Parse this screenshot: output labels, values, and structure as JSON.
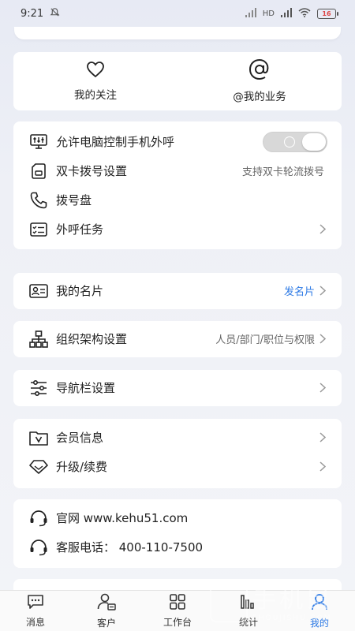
{
  "status_bar": {
    "time": "9:21",
    "network": "HD",
    "battery": "16"
  },
  "quick_links": [
    {
      "label": "我的关注",
      "icon": "heart-icon"
    },
    {
      "label": "@我的业务",
      "icon": "at-icon"
    }
  ],
  "dial_section": {
    "items": [
      {
        "title": "允许电脑控制手机外呼",
        "icon": "monitor-control-icon",
        "toggle": false
      },
      {
        "title": "双卡拨号设置",
        "icon": "sim-card-icon",
        "value": "支持双卡轮流拨号"
      },
      {
        "title": "拨号盘",
        "icon": "phone-icon"
      },
      {
        "title": "外呼任务",
        "icon": "task-list-icon"
      }
    ]
  },
  "business_card": {
    "title": "我的名片",
    "value": "发名片"
  },
  "org_setting": {
    "title": "组织架构设置",
    "value": "人员/部门/职位与权限"
  },
  "nav_setting": {
    "title": "导航栏设置"
  },
  "member": {
    "items": [
      {
        "title": "会员信息"
      },
      {
        "title": "升级/续费"
      }
    ]
  },
  "contact": {
    "website": "官网 www.kehu51.com",
    "hotline": "客服电话：  400-110-7500"
  },
  "tabs": [
    {
      "label": "消息",
      "icon": "message-icon"
    },
    {
      "label": "客户",
      "icon": "customer-icon"
    },
    {
      "label": "工作台",
      "icon": "workbench-icon"
    },
    {
      "label": "统计",
      "icon": "statistics-icon"
    },
    {
      "label": "我的",
      "icon": "profile-icon",
      "active": true
    }
  ],
  "colors": {
    "accent": "#2f7be5",
    "toggle_off": "#d8d8d8"
  },
  "watermark": {
    "big": "手机鼠",
    "small": "SHOUJISHU.COM"
  }
}
